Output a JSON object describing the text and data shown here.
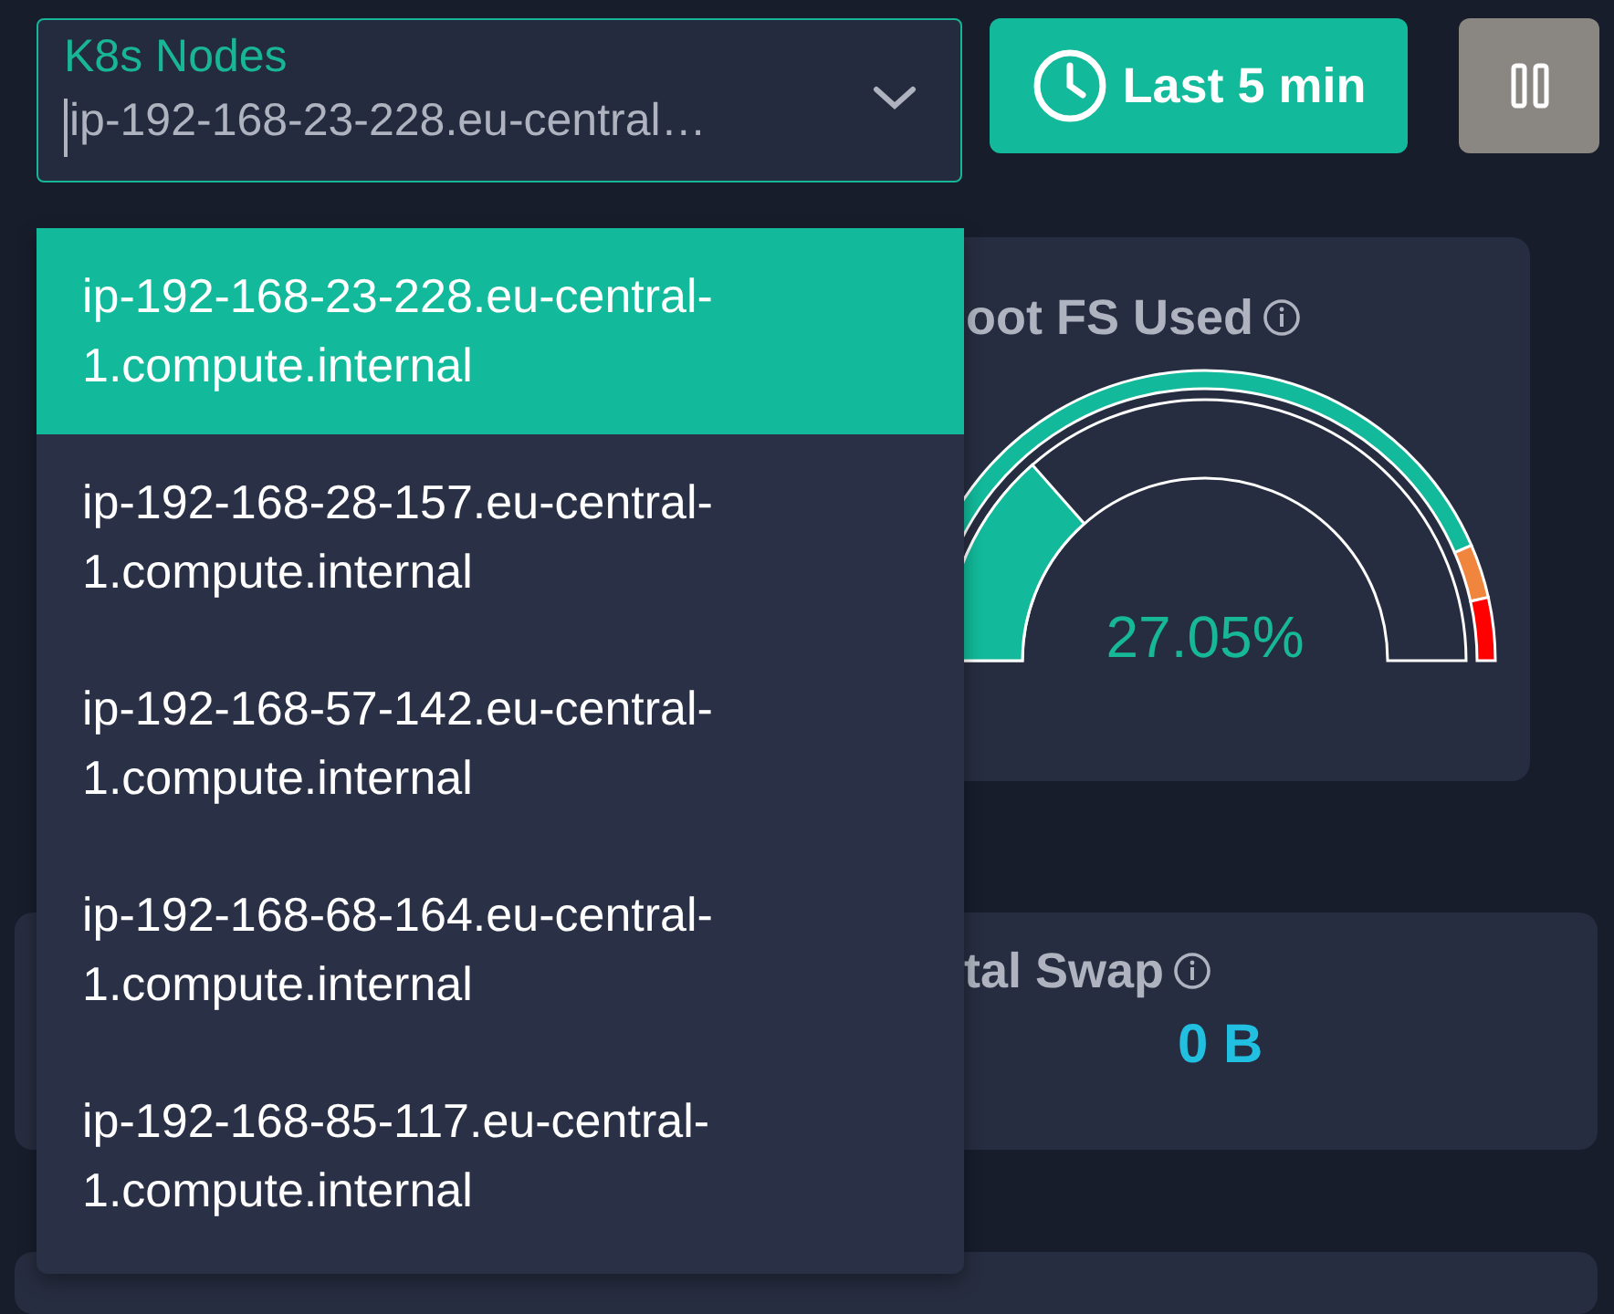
{
  "node_select": {
    "label": "K8s Nodes",
    "value": "ip-192-168-23-228.eu-central…"
  },
  "time_range_button": {
    "label": "Last 5 min"
  },
  "node_options": [
    {
      "label": "ip-192-168-23-228.eu-central-1.compute.internal",
      "selected": true
    },
    {
      "label": "ip-192-168-28-157.eu-central-1.compute.internal",
      "selected": false
    },
    {
      "label": "ip-192-168-57-142.eu-central-1.compute.internal",
      "selected": false
    },
    {
      "label": "ip-192-168-68-164.eu-central-1.compute.internal",
      "selected": false
    },
    {
      "label": "ip-192-168-85-117.eu-central-1.compute.internal",
      "selected": false
    }
  ],
  "root_fs_card": {
    "title": "oot FS Used",
    "reading": "27.05%"
  },
  "swap_card": {
    "title": "tal Swap",
    "value": "0 B"
  }
}
